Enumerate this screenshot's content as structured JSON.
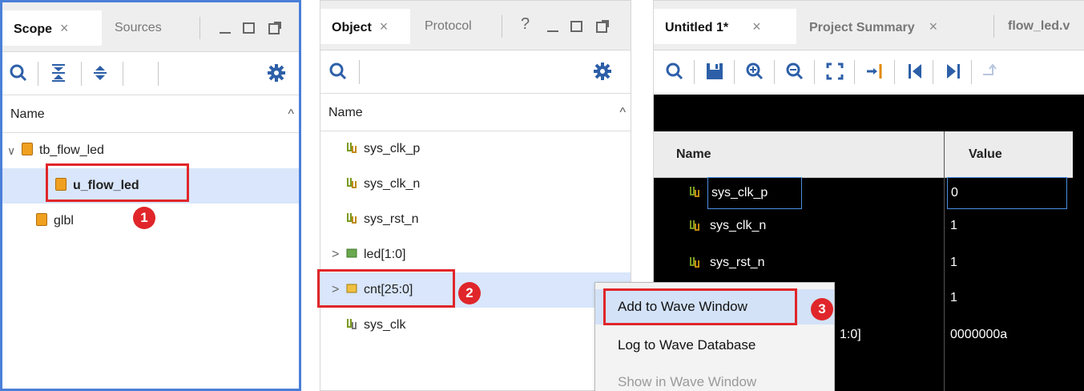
{
  "scope_panel": {
    "tabs": [
      {
        "label": "Scope",
        "close": "×"
      },
      {
        "label": "Sources"
      }
    ],
    "column_header": "Name",
    "tree": [
      {
        "label": "tb_flow_led",
        "expander": "∨"
      },
      {
        "label": "u_flow_led"
      },
      {
        "label": "glbl"
      }
    ]
  },
  "object_panel": {
    "tabs": [
      {
        "label": "Object",
        "close": "×"
      },
      {
        "label": "Protocol"
      }
    ],
    "help": "?",
    "column_header": "Name",
    "signals": [
      {
        "label": "sys_clk_p"
      },
      {
        "label": "sys_clk_n"
      },
      {
        "label": "sys_rst_n"
      },
      {
        "label": "led[1:0]",
        "expander": ">"
      },
      {
        "label": "cnt[25:0]",
        "expander": ">"
      },
      {
        "label": "sys_clk"
      }
    ]
  },
  "wave_panel": {
    "tabs": [
      {
        "label": "Untitled 1*",
        "close": "×"
      },
      {
        "label": "Project Summary",
        "close": "×"
      },
      {
        "label": "flow_led.v"
      }
    ],
    "columns": {
      "name": "Name",
      "value": "Value"
    },
    "rows": [
      {
        "name": "sys_clk_p",
        "value": "0"
      },
      {
        "name": "sys_clk_n",
        "value": "1"
      },
      {
        "name": "sys_rst_n",
        "value": "1"
      },
      {
        "name": "",
        "value": "1"
      },
      {
        "name": "1:0]",
        "value": "0000000a"
      }
    ]
  },
  "context_menu": {
    "items": [
      {
        "label": "Add to Wave Window"
      },
      {
        "label": "Log to Wave Database"
      },
      {
        "label": "Show in Wave Window"
      }
    ]
  },
  "annotations": {
    "badge1": "1",
    "badge2": "2",
    "badge3": "3"
  },
  "colors": {
    "highlight_red": "#e0262a",
    "active_panel_blue": "#4a7fd8",
    "selection_blue": "#d9e6fb"
  }
}
